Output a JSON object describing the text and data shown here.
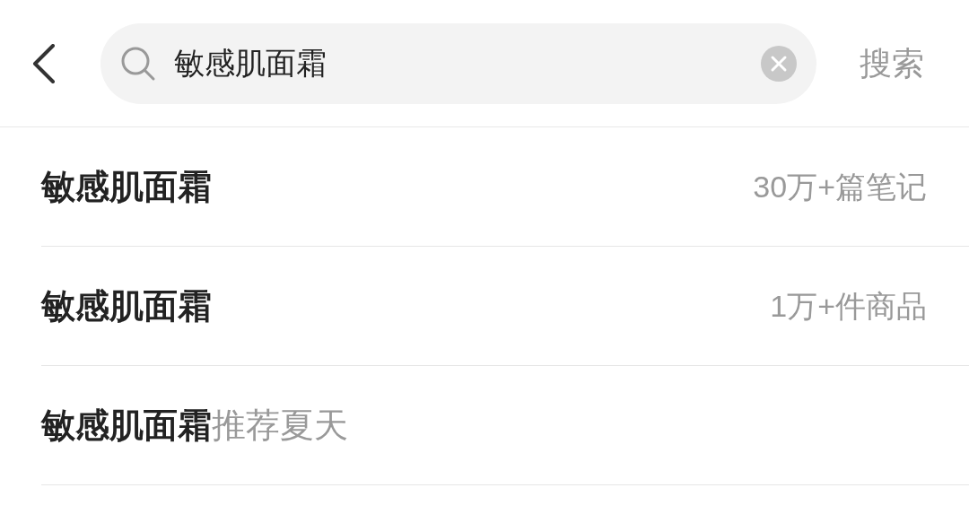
{
  "search": {
    "value": "敏感肌面霜",
    "button": "搜索"
  },
  "suggestions": [
    {
      "kind": "stat",
      "text": "敏感肌面霜",
      "count": "30万+篇笔记"
    },
    {
      "kind": "stat",
      "text": "敏感肌面霜",
      "count": "1万+件商品"
    },
    {
      "kind": "completion",
      "text": "**敏感肌面霜**推荐夏天"
    }
  ]
}
